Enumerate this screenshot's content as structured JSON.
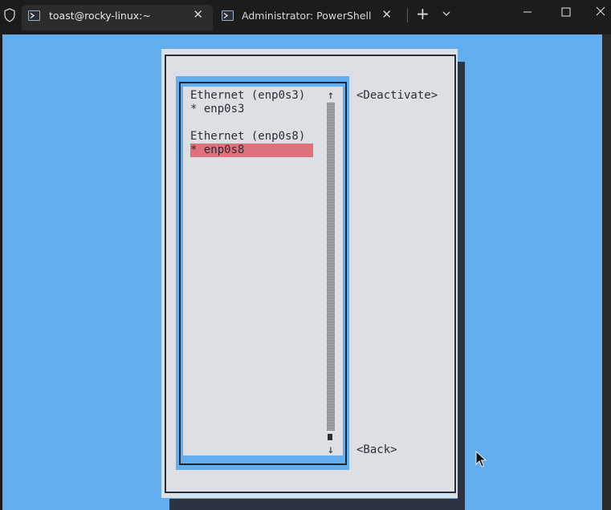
{
  "window": {
    "tabs": [
      {
        "label": "toast@rocky-linux:~",
        "icon": "terminal-prompt-icon",
        "active": true
      },
      {
        "label": "Administrator: PowerShell",
        "icon": "terminal-prompt-icon",
        "active": false
      }
    ],
    "controls": {
      "new_tab": "+",
      "close": "✕",
      "minimize": "─",
      "maximize": "☐"
    }
  },
  "nmtui": {
    "connections": [
      {
        "header": "Ethernet (enp0s3)",
        "item": "* enp0s3",
        "selected": false
      },
      {
        "header": "Ethernet (enp0s8)",
        "item": "* enp0s8",
        "selected": true
      }
    ],
    "scroll": {
      "up": "↑",
      "down": "↓"
    },
    "buttons": {
      "deactivate": "<Deactivate>",
      "back": "<Back>"
    }
  },
  "colors": {
    "terminal_background": "#62aeef",
    "dialog_background": "#dcdfe4",
    "selection": "#e0707a",
    "titlebar": "#1c1c1c"
  }
}
